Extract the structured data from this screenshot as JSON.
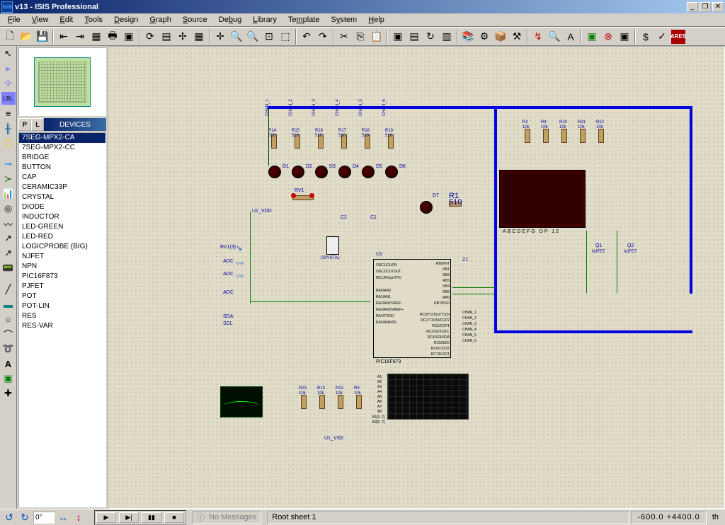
{
  "title": "v13 - ISIS Professional",
  "menus": [
    "File",
    "View",
    "Edit",
    "Tools",
    "Design",
    "Graph",
    "Source",
    "Debug",
    "Library",
    "Template",
    "System",
    "Help"
  ],
  "devices_header": "DEVICES",
  "devices": [
    "7SEG-MPX2-CA",
    "7SEG-MPX2-CC",
    "BRIDGE",
    "BUTTON",
    "CAP",
    "CERAMIC33P",
    "CRYSTAL",
    "DIODE",
    "INDUCTOR",
    "LED-GREEN",
    "LED-RED",
    "LOGICPROBE (BIG)",
    "NJFET",
    "NPN",
    "PIC16F873",
    "PJFET",
    "POT",
    "POT-LIN",
    "RES",
    "RES-VAR"
  ],
  "selected_device_idx": 0,
  "rotation": "0°",
  "status": {
    "msglabel": "No Messages",
    "sheet": "Root sheet 1",
    "coords": "-600.0  +4400.0",
    "unit": "th"
  },
  "schematic": {
    "leds": [
      "D1",
      "D2",
      "D3",
      "D4",
      "D5",
      "D6",
      "D7"
    ],
    "resistors_top": [
      {
        "name": "R14",
        "val": "510"
      },
      {
        "name": "R15",
        "val": "510"
      },
      {
        "name": "R16",
        "val": "510"
      },
      {
        "name": "R17",
        "val": "510"
      },
      {
        "name": "R18",
        "val": "510"
      },
      {
        "name": "R19",
        "val": "510"
      }
    ],
    "resistors_right": [
      {
        "name": "R2",
        "val": "10k"
      },
      {
        "name": "R4",
        "val": "10k"
      },
      {
        "name": "R20",
        "val": "10k"
      },
      {
        "name": "R21",
        "val": "10k"
      },
      {
        "name": "R22",
        "val": "10k"
      }
    ],
    "resistors_bottom": [
      {
        "name": "R23",
        "val": "10k"
      },
      {
        "name": "R13",
        "val": "10k"
      },
      {
        "name": "R12",
        "val": "10k"
      },
      {
        "name": "R3",
        "val": "10k"
      }
    ],
    "resistor_d7": {
      "name": "R1",
      "val": "510"
    },
    "pot": "RV1",
    "crystal": "CRYSTAL",
    "caps": [
      "C2",
      "C1"
    ],
    "mcu": "U1",
    "mcu_part": "PIC16F873",
    "mcu_left_pins": [
      "OSC1/CLKIN",
      "OSC2/CLKOUT",
      "MCLR/Vpp/THV",
      "",
      "RA0/AN0",
      "RA1/AN1",
      "RA2/AN2/VREF-",
      "RA3/AN3/VREF+",
      "RA4/T0CKI",
      "RA5/AN4/SS"
    ],
    "mcu_right_pins": [
      "RB0/INT",
      "RB1",
      "RB2",
      "RB3",
      "RB4",
      "RB5",
      "RB6",
      "RB7/PGD",
      "",
      "RC0/T1OSO/T1CKI",
      "RC1/T1OSI/CCP2",
      "RC2/CCP1",
      "RC3/SCK/SCL",
      "RC4/SDI/SDA",
      "RC5/SDO",
      "RC6/TX/CK",
      "RC7/RX/DT"
    ],
    "channels": [
      "CHAN_1",
      "CHAN_2",
      "CHAN_3",
      "CHAN_4",
      "CHAN_5",
      "CHAN_6"
    ],
    "seg_pins": "ABCDEFG  DP     12",
    "trans": [
      "Q1",
      "Q2"
    ],
    "trans_type": "NJFET",
    "gnd": "U1_VDD",
    "gnd2": "U1_VSS",
    "adc": "ADC",
    "sda": "SDA",
    "scl": "SCL",
    "rv_wire": "RV1(3)",
    "net_z1": "Z1",
    "analog_pins": [
      "A1",
      "A2",
      "A3",
      "A4",
      "A5",
      "A6",
      "A7",
      "A8"
    ],
    "bus_pins": [
      "B1[0..7]",
      "B2[0..7]"
    ]
  }
}
